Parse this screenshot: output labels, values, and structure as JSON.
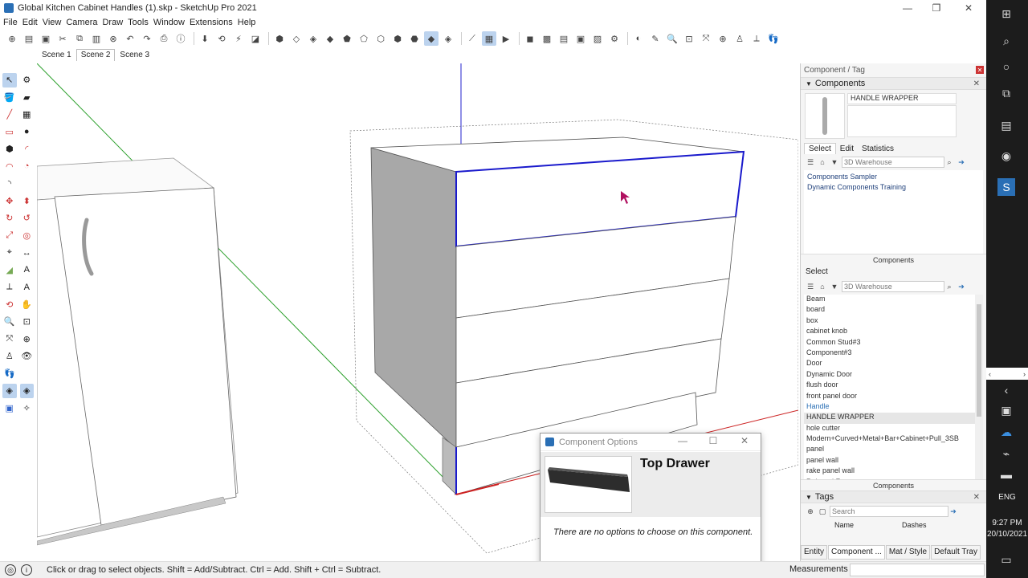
{
  "window": {
    "title": "Global Kitchen Cabinet Handles (1).skp - SketchUp Pro 2021",
    "minimize": "—",
    "maximize": "❐",
    "close": "✕"
  },
  "menu": [
    "File",
    "Edit",
    "View",
    "Camera",
    "Draw",
    "Tools",
    "Window",
    "Extensions",
    "Help"
  ],
  "scenes": [
    {
      "label": "Scene 1",
      "active": false
    },
    {
      "label": "Scene 2",
      "active": true
    },
    {
      "label": "Scene 3",
      "active": false
    }
  ],
  "toolbar_icons": [
    "new-icon",
    "open-icon",
    "save-icon",
    "cut-icon",
    "copy-icon",
    "paste-icon",
    "erase-icon",
    "undo-icon",
    "redo-icon",
    "print-icon",
    "model-info-icon",
    "sep",
    "push-icon",
    "orbit-icon",
    "pan-icon",
    "section-icon",
    "sep",
    "iso-icon",
    "top-icon",
    "front-icon",
    "right-icon",
    "back-icon",
    "left-icon",
    "xray-icon",
    "wireframe-icon",
    "hidden-line-icon",
    "shaded-icon",
    "textured-icon",
    "sep",
    "tape-icon",
    "scene-icon",
    "play-icon",
    "sep",
    "warehouse-icon",
    "ext-warehouse-icon",
    "layout-icon",
    "style-builder-icon",
    "trimble-icon",
    "advanced-camera-icon",
    "sep",
    "position-camera-icon",
    "walk-icon",
    "zoom-icon",
    "zoom-window-icon",
    "zoom-extents-icon",
    "zoom-previous-icon",
    "look-around-icon",
    "axes-icon",
    "footprints-icon"
  ],
  "status": {
    "hint": "Click or drag to select objects. Shift = Add/Subtract. Ctrl = Add. Shift + Ctrl = Subtract.",
    "measurements_label": "Measurements"
  },
  "dialog": {
    "title": "Component Options",
    "component_name": "Top Drawer",
    "message": "There are no options to choose on this component."
  },
  "tray": {
    "title": "Component / Tag",
    "components_panel": {
      "header": "Components",
      "name_field": "HANDLE WRAPPER",
      "tabs": [
        "Select",
        "Edit",
        "Statistics"
      ],
      "search_placeholder": "3D Warehouse",
      "collections": [
        "Components Sampler",
        "Dynamic Components Training"
      ],
      "footer_label": "Components"
    },
    "select_panel": {
      "label": "Select",
      "search_placeholder": "3D Warehouse",
      "items": [
        "Beam",
        "board",
        "box",
        "cabinet knob",
        "Common Stud#3",
        "Component#3",
        "Door",
        "Dynamic Door",
        "flush door",
        "front panel door",
        "Handle",
        "HANDLE WRAPPER",
        "hole cutter",
        "Modern+Curved+Metal+Bar+Cabinet+Pull_3SB",
        "panel",
        "panel wall",
        "rake panel wall",
        "Rabeted Face"
      ],
      "selected_index": 11,
      "highlight_index": 10,
      "footer_label": "Components"
    },
    "tags_panel": {
      "header": "Tags",
      "search_placeholder": "Search",
      "col_name": "Name",
      "col_dashes": "Dashes"
    },
    "bottom_tabs": [
      "Entity",
      "Component ...",
      "Mat / Style",
      "Default Tray"
    ],
    "active_bottom_tab": 1
  },
  "taskbar": {
    "time": "9:27 PM",
    "date": "20/10/2021",
    "language": "ENG"
  },
  "colors": {
    "selection_blue": "#1a1acc",
    "axis_green": "#2ca02c",
    "axis_red": "#cc2222",
    "axis_blue": "#2222cc",
    "side_panel_grey": "#a8a8a8"
  }
}
